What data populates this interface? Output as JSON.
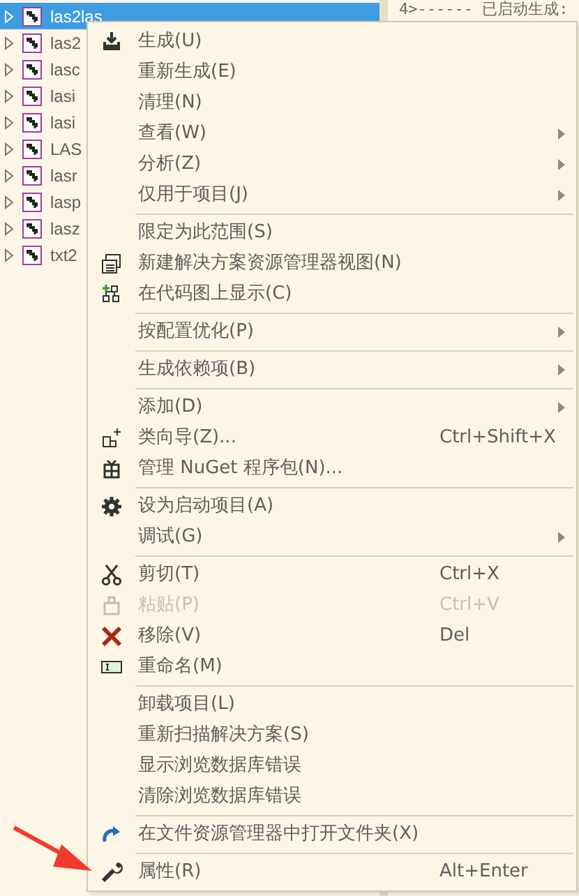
{
  "solution_tree": {
    "items": [
      {
        "label": "las2las",
        "selected": true
      },
      {
        "label": "las2",
        "selected": false
      },
      {
        "label": "lasc",
        "selected": false
      },
      {
        "label": "lasi",
        "selected": false
      },
      {
        "label": "lasi",
        "selected": false
      },
      {
        "label": "LAS",
        "selected": false
      },
      {
        "label": "lasr",
        "selected": false
      },
      {
        "label": "lasp",
        "selected": false
      },
      {
        "label": "lasz",
        "selected": false
      },
      {
        "label": "txt2",
        "selected": false
      }
    ]
  },
  "output": {
    "line": "4>------ 已启动生成:"
  },
  "context_menu": {
    "items": [
      {
        "kind": "command",
        "label": "生成(U)",
        "submenu": false,
        "disabled": false
      },
      {
        "kind": "command",
        "label": "重新生成(E)",
        "submenu": false,
        "disabled": false
      },
      {
        "kind": "command",
        "label": "清理(N)",
        "submenu": false,
        "disabled": false
      },
      {
        "kind": "command",
        "label": "查看(W)",
        "submenu": true,
        "disabled": false
      },
      {
        "kind": "command",
        "label": "分析(Z)",
        "submenu": true,
        "disabled": false
      },
      {
        "kind": "command",
        "label": "仅用于项目(J)",
        "submenu": true,
        "disabled": false
      },
      {
        "kind": "separator"
      },
      {
        "kind": "command",
        "label": "限定为此范围(S)",
        "submenu": false,
        "disabled": false
      },
      {
        "kind": "command",
        "label": "新建解决方案资源管理器视图(N)",
        "submenu": false,
        "disabled": false
      },
      {
        "kind": "command",
        "label": "在代码图上显示(C)",
        "submenu": false,
        "disabled": false
      },
      {
        "kind": "separator"
      },
      {
        "kind": "command",
        "label": "按配置优化(P)",
        "submenu": true,
        "disabled": false
      },
      {
        "kind": "separator"
      },
      {
        "kind": "command",
        "label": "生成依赖项(B)",
        "submenu": true,
        "disabled": false
      },
      {
        "kind": "separator"
      },
      {
        "kind": "command",
        "label": "添加(D)",
        "submenu": true,
        "disabled": false
      },
      {
        "kind": "command",
        "label": "类向导(Z)...",
        "shortcut": "Ctrl+Shift+X",
        "submenu": false,
        "disabled": false
      },
      {
        "kind": "command",
        "label": "管理 NuGet 程序包(N)...",
        "submenu": false,
        "disabled": false
      },
      {
        "kind": "separator"
      },
      {
        "kind": "command",
        "label": "设为启动项目(A)",
        "submenu": false,
        "disabled": false
      },
      {
        "kind": "command",
        "label": "调试(G)",
        "submenu": true,
        "disabled": false
      },
      {
        "kind": "separator"
      },
      {
        "kind": "command",
        "label": "剪切(T)",
        "shortcut": "Ctrl+X",
        "submenu": false,
        "disabled": false
      },
      {
        "kind": "command",
        "label": "粘贴(P)",
        "shortcut": "Ctrl+V",
        "submenu": false,
        "disabled": true
      },
      {
        "kind": "command",
        "label": "移除(V)",
        "shortcut": "Del",
        "submenu": false,
        "disabled": false
      },
      {
        "kind": "command",
        "label": "重命名(M)",
        "submenu": false,
        "disabled": false
      },
      {
        "kind": "separator"
      },
      {
        "kind": "command",
        "label": "卸载项目(L)",
        "submenu": false,
        "disabled": false
      },
      {
        "kind": "command",
        "label": "重新扫描解决方案(S)",
        "submenu": false,
        "disabled": false
      },
      {
        "kind": "command",
        "label": "显示浏览数据库错误",
        "submenu": false,
        "disabled": false
      },
      {
        "kind": "command",
        "label": "清除浏览数据库错误",
        "submenu": false,
        "disabled": false
      },
      {
        "kind": "separator"
      },
      {
        "kind": "command",
        "label": "在文件资源管理器中打开文件夹(X)",
        "submenu": false,
        "disabled": false
      },
      {
        "kind": "separator"
      },
      {
        "kind": "command",
        "label": "属性(R)",
        "shortcut": "Alt+Enter",
        "submenu": false,
        "disabled": false
      }
    ]
  }
}
